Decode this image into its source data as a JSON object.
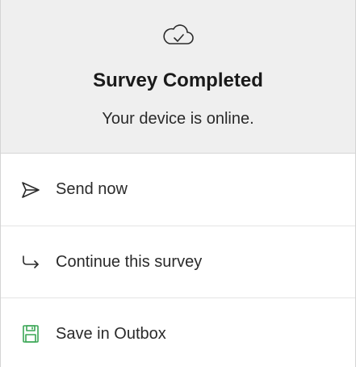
{
  "header": {
    "icon": "cloud-check-icon",
    "title": "Survey Completed",
    "subtitle": "Your device is online."
  },
  "options": [
    {
      "label": "Send now",
      "icon": "send-icon"
    },
    {
      "label": "Continue this survey",
      "icon": "arrow-return-icon"
    },
    {
      "label": "Save in Outbox",
      "icon": "save-icon",
      "icon_color": "#3aa655"
    }
  ],
  "colors": {
    "header_bg": "#efefef",
    "save_accent": "#3aa655"
  }
}
